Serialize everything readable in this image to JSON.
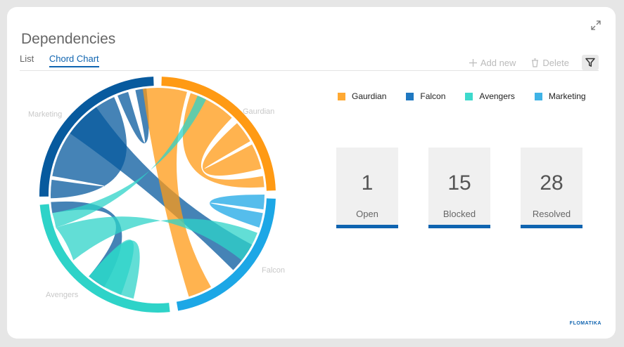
{
  "header": {
    "title": "Dependencies"
  },
  "tabs": [
    {
      "label": "List",
      "active": false
    },
    {
      "label": "Chord Chart",
      "active": true
    }
  ],
  "toolbar": {
    "add_label": "Add new",
    "delete_label": "Delete"
  },
  "brand": "FLOMATIKA",
  "legend": [
    {
      "label": "Gaurdian",
      "color": "#ffa933"
    },
    {
      "label": "Falcon",
      "color": "#1f78c1"
    },
    {
      "label": "Avengers",
      "color": "#3dd9cc"
    },
    {
      "label": "Marketing",
      "color": "#3fb3e6"
    }
  ],
  "stats": [
    {
      "value": "1",
      "label": "Open"
    },
    {
      "value": "15",
      "label": "Blocked"
    },
    {
      "value": "28",
      "label": "Resolved"
    }
  ],
  "chart_data": {
    "type": "chord",
    "groups": [
      {
        "name": "Gaurdian",
        "color": "#ff9a14"
      },
      {
        "name": "Falcon",
        "color": "#1ca7e6"
      },
      {
        "name": "Avengers",
        "color": "#2ed3c8"
      },
      {
        "name": "Marketing",
        "color": "#075a9e"
      }
    ]
  }
}
